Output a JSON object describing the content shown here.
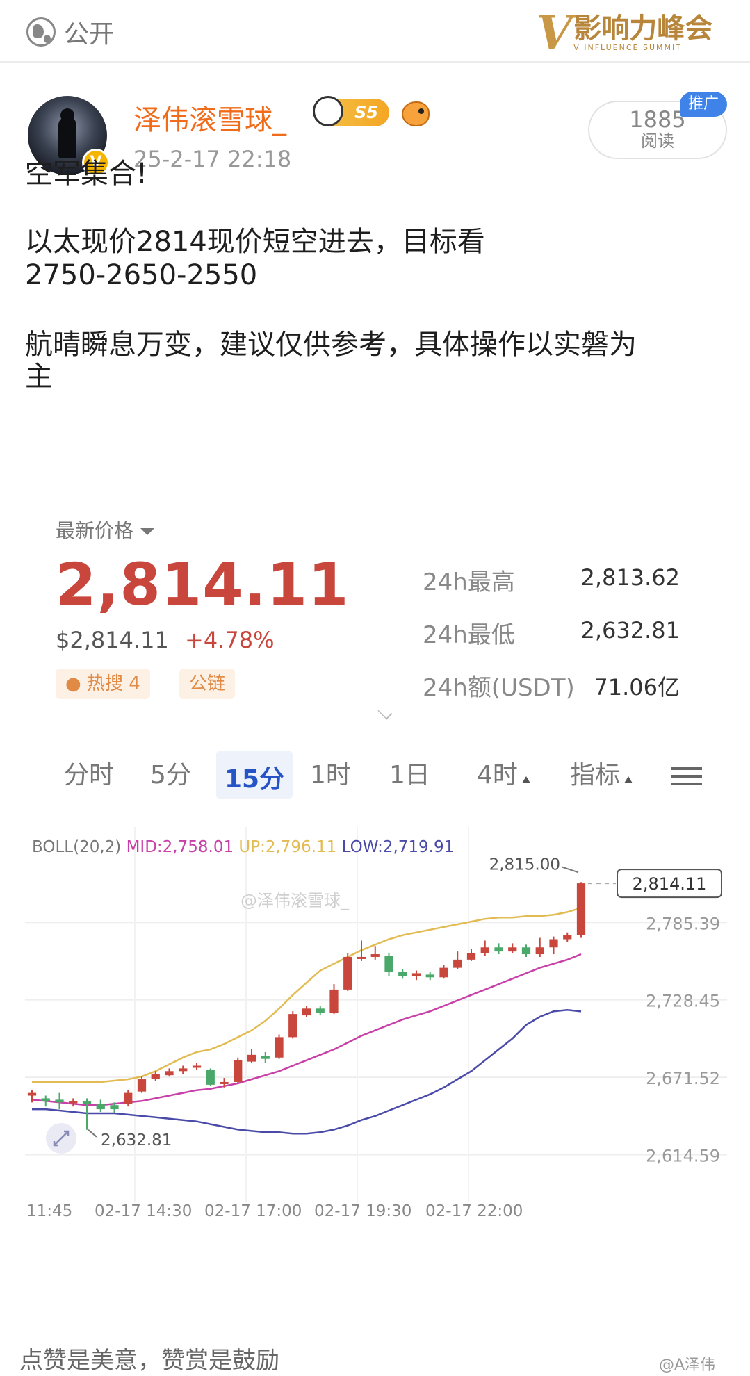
{
  "header": {
    "visibility": "公开",
    "logo_v": "V",
    "logo_cn": "影响力峰会",
    "logo_en": "V INFLUENCE SUMMIT"
  },
  "post": {
    "author": "泽伟滚雪球_",
    "level": "S5",
    "verified_mark": "V",
    "timestamp": "25-2-17 22:18",
    "reads": "1885",
    "reads_label": "阅读",
    "promo_label": "推广",
    "line1": "空军集合!",
    "line2": "以太现价2814现价短空进去，目标看",
    "line3": "2750-2650-2550",
    "line4": "航晴瞬息万变，建议仅供参考，具体操作以实磐为",
    "line5": "主"
  },
  "market": {
    "price_label": "最新价格",
    "price": "2,814.11",
    "usd_price": "$2,814.11",
    "change": "+4.78%",
    "tag_hot": "热搜 4",
    "tag_chain": "公链",
    "stats": [
      {
        "label": "24h最高",
        "value": "2,813.62"
      },
      {
        "label": "24h最低",
        "value": "2,632.81"
      },
      {
        "label": "24h额(USDT)",
        "value": "71.06亿"
      }
    ],
    "tabs": [
      "分时",
      "5分",
      "15分",
      "1时",
      "1日",
      "4时",
      "指标"
    ],
    "active_tab": "15分"
  },
  "chart_data": {
    "type": "candlestick",
    "boll_label": "BOLL(20,2)",
    "mid_label": "MID:2,758.01",
    "up_label": "UP:2,796.11",
    "low_label": "LOW:2,719.91",
    "watermark": "@泽伟滚雪球_",
    "current_price_label": "2,814.11",
    "high_annotation": "2,815.00",
    "low_annotation": "2,632.81",
    "yticks": [
      "2,785.39",
      "2,728.45",
      "2,671.52",
      "2,614.59"
    ],
    "ytick_values": [
      2785.39,
      2728.45,
      2671.52,
      2614.59
    ],
    "xticks": [
      "11:45",
      "02-17 14:30",
      "02-17 17:00",
      "02-17 19:30",
      "02-17 22:00"
    ],
    "ylim": [
      2600,
      2830
    ],
    "colors": {
      "up": "#c9463d",
      "down": "#4aa86a",
      "mid": "#c83fa8",
      "upper": "#e2bb52",
      "lower": "#4a4aa8"
    },
    "candles": [
      [
        2658,
        2660,
        2653,
        2662
      ],
      [
        2656,
        2654,
        2650,
        2658
      ],
      [
        2655,
        2653,
        2648,
        2660
      ],
      [
        2653,
        2654,
        2650,
        2656
      ],
      [
        2654,
        2652,
        2632.81,
        2656
      ],
      [
        2652,
        2648,
        2646,
        2655
      ],
      [
        2651,
        2648,
        2645,
        2653
      ],
      [
        2652,
        2660,
        2650,
        2662
      ],
      [
        2661,
        2670,
        2660,
        2672
      ],
      [
        2670,
        2674,
        2669,
        2676
      ],
      [
        2673,
        2676,
        2672,
        2678
      ],
      [
        2676,
        2678,
        2674,
        2680
      ],
      [
        2679,
        2680,
        2677,
        2682
      ],
      [
        2677,
        2666,
        2665,
        2678
      ],
      [
        2667,
        2668,
        2664,
        2671
      ],
      [
        2668,
        2684,
        2667,
        2686
      ],
      [
        2683,
        2688,
        2682,
        2692
      ],
      [
        2687,
        2685,
        2682,
        2690
      ],
      [
        2686,
        2701,
        2685,
        2703
      ],
      [
        2701,
        2718,
        2700,
        2720
      ],
      [
        2717,
        2722,
        2716,
        2724
      ],
      [
        2722,
        2719,
        2717,
        2724
      ],
      [
        2719,
        2736,
        2718,
        2740
      ],
      [
        2736,
        2760,
        2735,
        2763
      ],
      [
        2759,
        2760,
        2757,
        2772
      ],
      [
        2760,
        2762,
        2758,
        2768
      ],
      [
        2761,
        2749,
        2746,
        2763
      ],
      [
        2749,
        2746,
        2744,
        2751
      ],
      [
        2746,
        2748,
        2743,
        2750
      ],
      [
        2747,
        2745,
        2743,
        2749
      ],
      [
        2745,
        2752,
        2744,
        2754
      ],
      [
        2752,
        2758,
        2751,
        2764
      ],
      [
        2758,
        2763,
        2757,
        2766
      ],
      [
        2763,
        2767,
        2761,
        2772
      ],
      [
        2767,
        2764,
        2762,
        2770
      ],
      [
        2764,
        2767,
        2763,
        2770
      ],
      [
        2767,
        2762,
        2760,
        2769
      ],
      [
        2762,
        2767,
        2760,
        2774
      ],
      [
        2767,
        2773,
        2762,
        2775
      ],
      [
        2773,
        2776,
        2771,
        2778
      ],
      [
        2776,
        2814.11,
        2774,
        2815
      ]
    ],
    "mid": [
      2655,
      2654,
      2653,
      2652,
      2651,
      2651,
      2652,
      2653,
      2654,
      2656,
      2658,
      2660,
      2662,
      2663,
      2665,
      2667,
      2670,
      2673,
      2676,
      2680,
      2684,
      2688,
      2692,
      2697,
      2702,
      2706,
      2710,
      2714,
      2717,
      2720,
      2724,
      2728,
      2732,
      2736,
      2740,
      2744,
      2748,
      2752,
      2755,
      2758,
      2762
    ],
    "upper": [
      2668,
      2668,
      2668,
      2668,
      2668,
      2668,
      2669,
      2670,
      2672,
      2676,
      2681,
      2686,
      2690,
      2692,
      2696,
      2701,
      2706,
      2713,
      2722,
      2732,
      2741,
      2750,
      2755,
      2760,
      2765,
      2769,
      2773,
      2776,
      2778,
      2780,
      2782,
      2784,
      2786,
      2788,
      2789,
      2789,
      2790,
      2790,
      2791,
      2793,
      2796.11
    ],
    "lower": [
      2648,
      2648,
      2647,
      2646,
      2645,
      2645,
      2645,
      2644,
      2643,
      2642,
      2641,
      2640,
      2639,
      2637,
      2635,
      2633,
      2632,
      2631,
      2631,
      2630,
      2630,
      2631,
      2633,
      2636,
      2640,
      2643,
      2647,
      2651,
      2655,
      2659,
      2664,
      2670,
      2676,
      2684,
      2692,
      2700,
      2710,
      2716,
      2720,
      2721,
      2719.91
    ]
  },
  "footer": {
    "text": "点赞是美意，赞赏是鼓励",
    "watermark": "@A泽伟"
  }
}
